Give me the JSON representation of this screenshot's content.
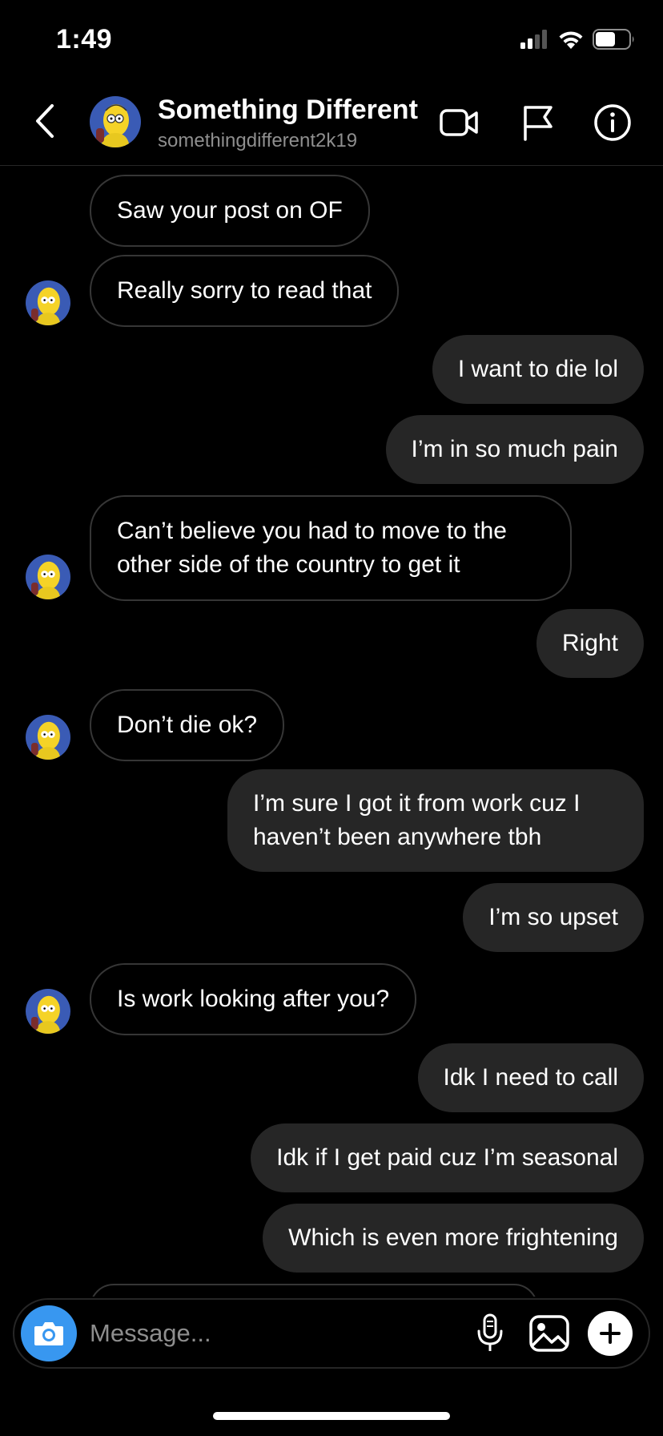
{
  "status": {
    "time": "1:49"
  },
  "header": {
    "title": "Something Different",
    "username": "somethingdifferent2k19"
  },
  "messages": [
    {
      "sender": "them",
      "text": "Saw your post on OF"
    },
    {
      "sender": "them",
      "text": "Really sorry to read that"
    },
    {
      "sender": "me",
      "text": "I want to die lol"
    },
    {
      "sender": "me",
      "text": "I’m in so much pain"
    },
    {
      "sender": "them",
      "text": "Can’t believe you had to move to the other side of the country to get it"
    },
    {
      "sender": "me",
      "text": "Right"
    },
    {
      "sender": "them",
      "text": "Don’t die ok?"
    },
    {
      "sender": "me",
      "text": "I’m sure I got it from work cuz I haven’t been anywhere tbh"
    },
    {
      "sender": "me",
      "text": "I’m so upset"
    },
    {
      "sender": "them",
      "text": "Is work looking after you?"
    },
    {
      "sender": "me",
      "text": "Idk I need to call"
    },
    {
      "sender": "me",
      "text": "Idk if I get paid cuz I’m seasonal"
    },
    {
      "sender": "me",
      "text": "Which is even more frightening"
    }
  ],
  "composer": {
    "placeholder": "Message..."
  },
  "colors": {
    "accent": "#3897f0",
    "outgoing_bubble": "#262626",
    "incoming_border": "#363636",
    "background": "#000000"
  }
}
